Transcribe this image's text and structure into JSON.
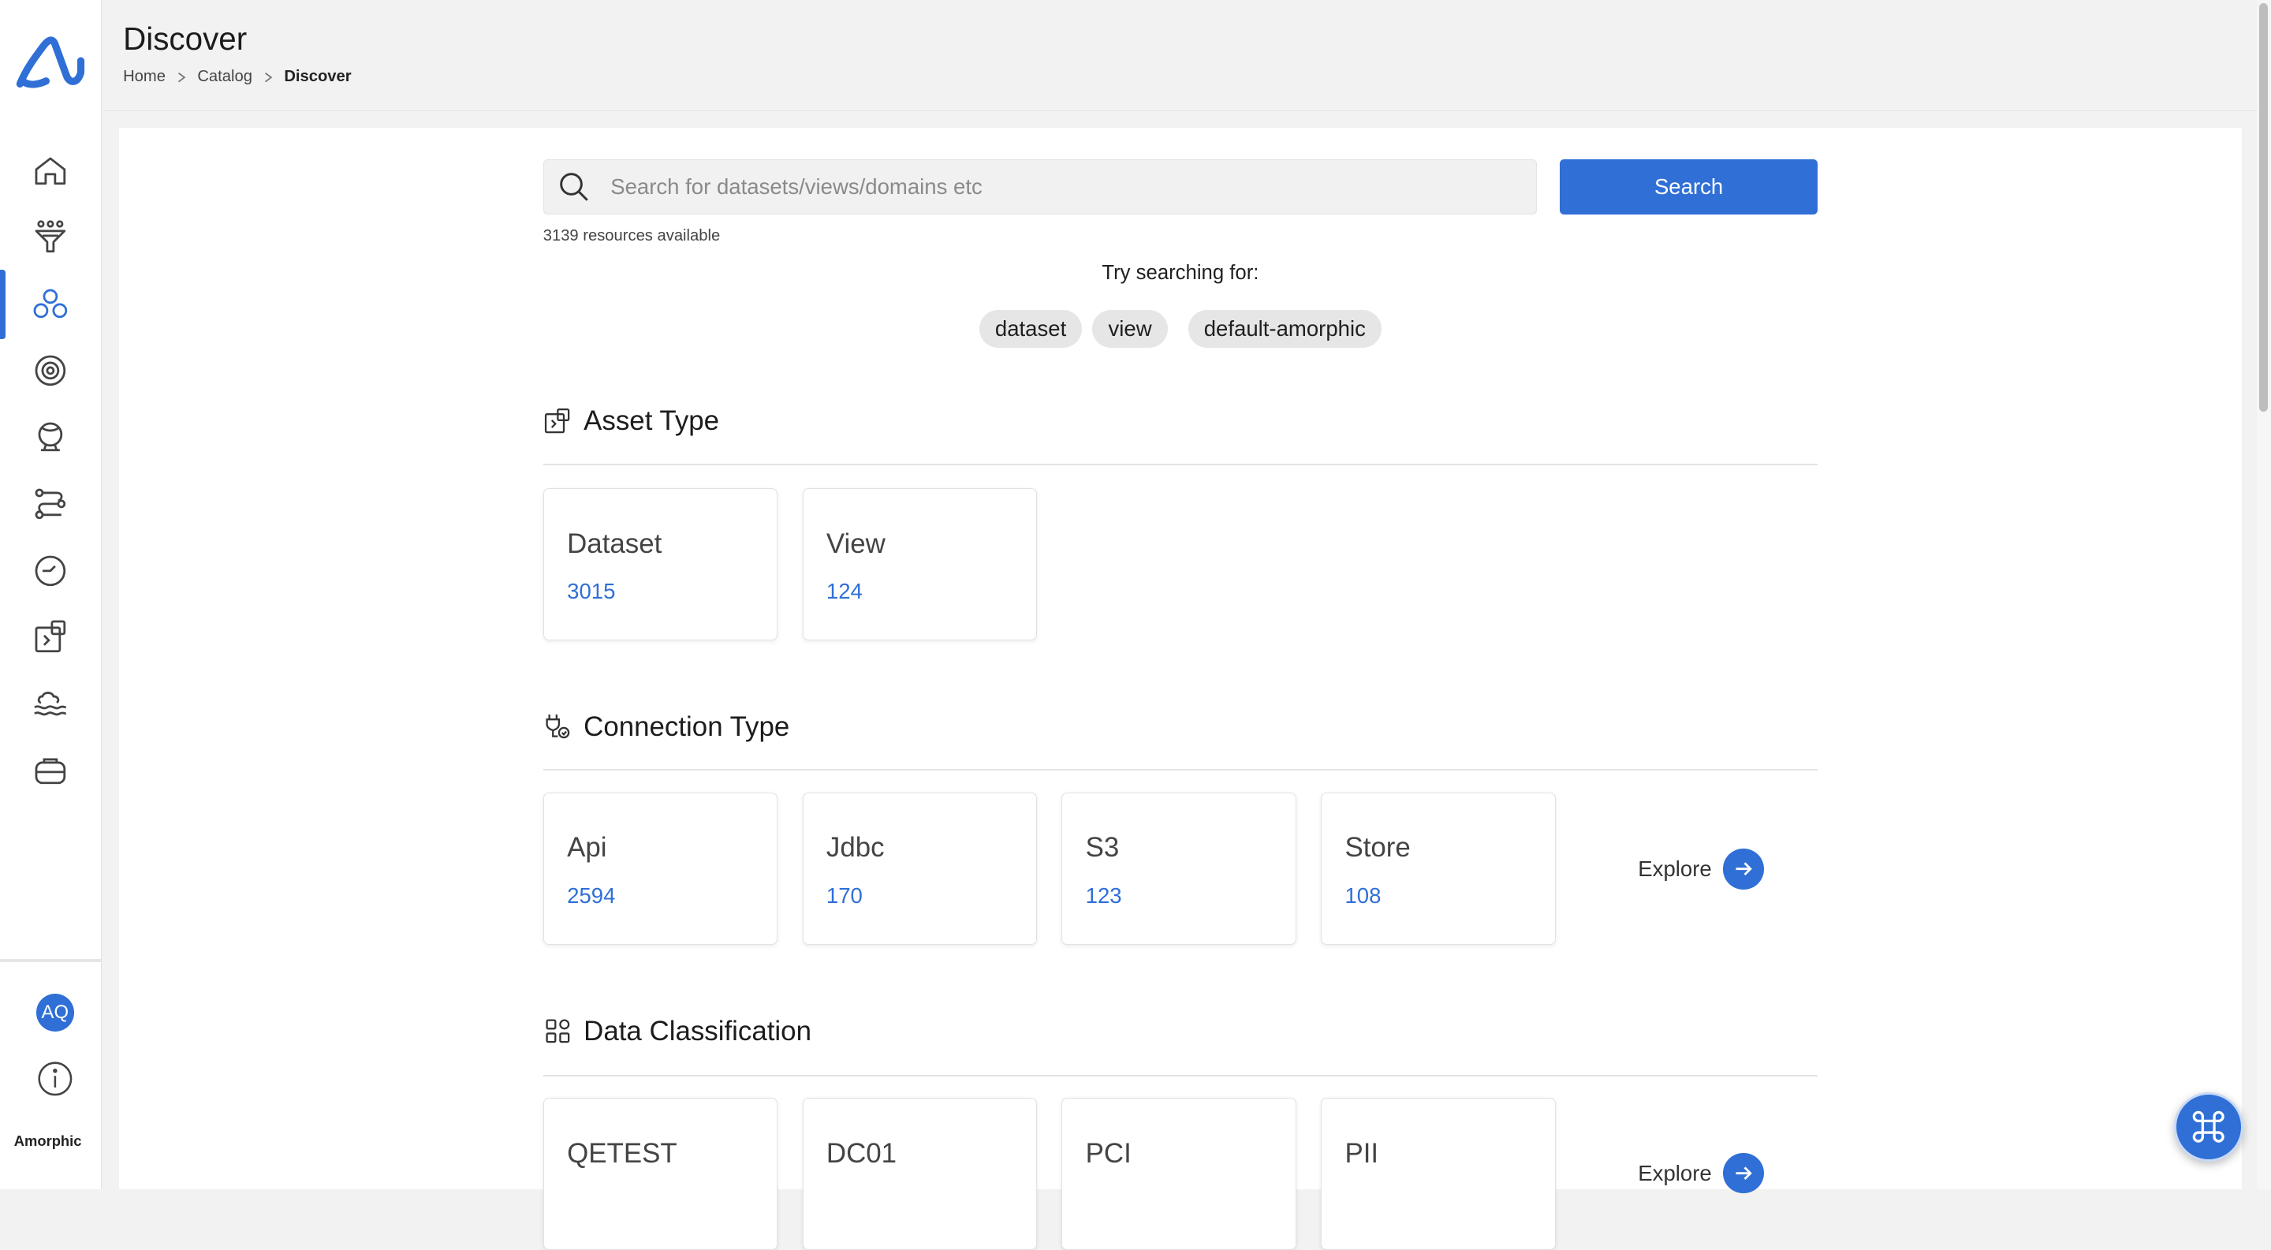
{
  "app": {
    "brand": "Amorphic"
  },
  "header": {
    "title": "Discover",
    "breadcrumb": [
      "Home",
      "Catalog",
      "Discover"
    ]
  },
  "user": {
    "initials": "AQ"
  },
  "search": {
    "placeholder": "Search for datasets/views/domains etc",
    "button_label": "Search",
    "resources": "3139 resources available",
    "try_label": "Try searching for:",
    "suggestions": [
      "dataset",
      "view",
      "default-amorphic"
    ]
  },
  "sections": {
    "asset_type": {
      "title": "Asset Type",
      "cards": [
        {
          "label": "Dataset",
          "value": "3015"
        },
        {
          "label": "View",
          "value": "124"
        }
      ]
    },
    "connection_type": {
      "title": "Connection Type",
      "cards": [
        {
          "label": "Api",
          "value": "2594"
        },
        {
          "label": "Jdbc",
          "value": "170"
        },
        {
          "label": "S3",
          "value": "123"
        },
        {
          "label": "Store",
          "value": "108"
        }
      ],
      "explore": "Explore"
    },
    "data_classification": {
      "title": "Data Classification",
      "cards": [
        {
          "label": "QETEST"
        },
        {
          "label": "DC01"
        },
        {
          "label": "PCI"
        },
        {
          "label": "PII"
        }
      ],
      "explore": "Explore"
    }
  },
  "colors": {
    "accent": "#2f6fd6",
    "background": "#f2f2f2",
    "card_border": "#e2e2e2"
  },
  "sidebar_icons": [
    "home-icon",
    "funnel-icon",
    "catalog-icon",
    "settings-gear-icon",
    "globe-icon",
    "workflow-icon",
    "clock-icon",
    "puzzle-icon",
    "cloud-lake-icon",
    "briefcase-icon"
  ]
}
